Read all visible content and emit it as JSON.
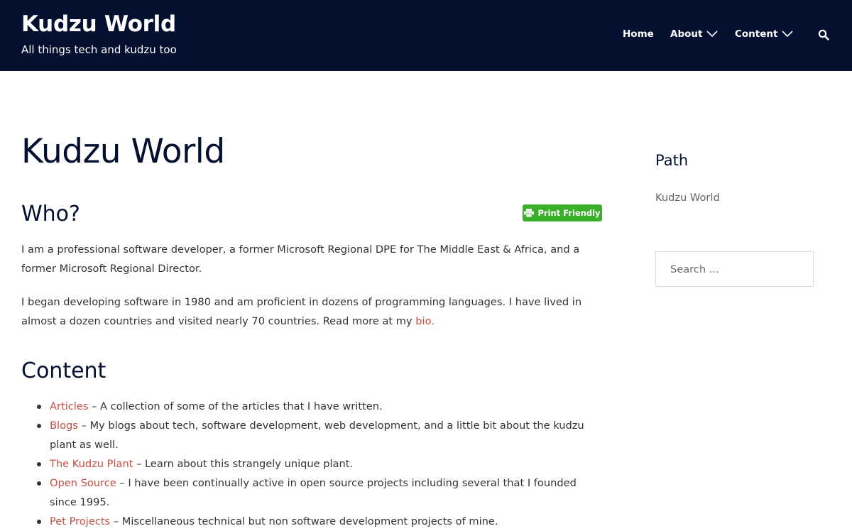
{
  "site": {
    "title": "Kudzu World",
    "tagline": "All things tech and kudzu too"
  },
  "nav": {
    "items": [
      {
        "label": "Home"
      },
      {
        "label": "About"
      },
      {
        "label": "Content"
      }
    ],
    "search_icon": "search-icon"
  },
  "page": {
    "title": "Kudzu World",
    "who_heading": "Who?",
    "print_label": "Print Friendly",
    "who_para1": "I am a professional software developer, a former Microsoft Regional DPE for The Middle East & Africa, and a former Microsoft Regional Director.",
    "who_para2_text": "I began developing software in 1980 and am proficient in dozens of programming languages. I have lived in almost a dozen countries and visited nearly 70 countries. Read more at my ",
    "who_para2_link": "bio.",
    "content_heading": "Content",
    "content_items": [
      {
        "link": "Articles",
        "text": " – A collection of some of the articles that I have written."
      },
      {
        "link": "Blogs",
        "text": " – My blogs about tech, software development, web development, and a little bit about the kudzu plant as well."
      },
      {
        "link": "The Kudzu Plant",
        "text": " – Learn about this strangely unique plant."
      },
      {
        "link": "Open Source",
        "text": " – I have been continually active in open source projects including several that I founded since 1995."
      },
      {
        "link": "Pet Projects",
        "text": " – Miscellaneous technical but non software development projects of mine."
      }
    ]
  },
  "sidebar": {
    "path_title": "Path",
    "path_link": "Kudzu World",
    "search_placeholder": "Search ..."
  },
  "colors": {
    "header_bg": "#03102f",
    "link": "#c44d43",
    "print_button": "#3aaf2a"
  }
}
